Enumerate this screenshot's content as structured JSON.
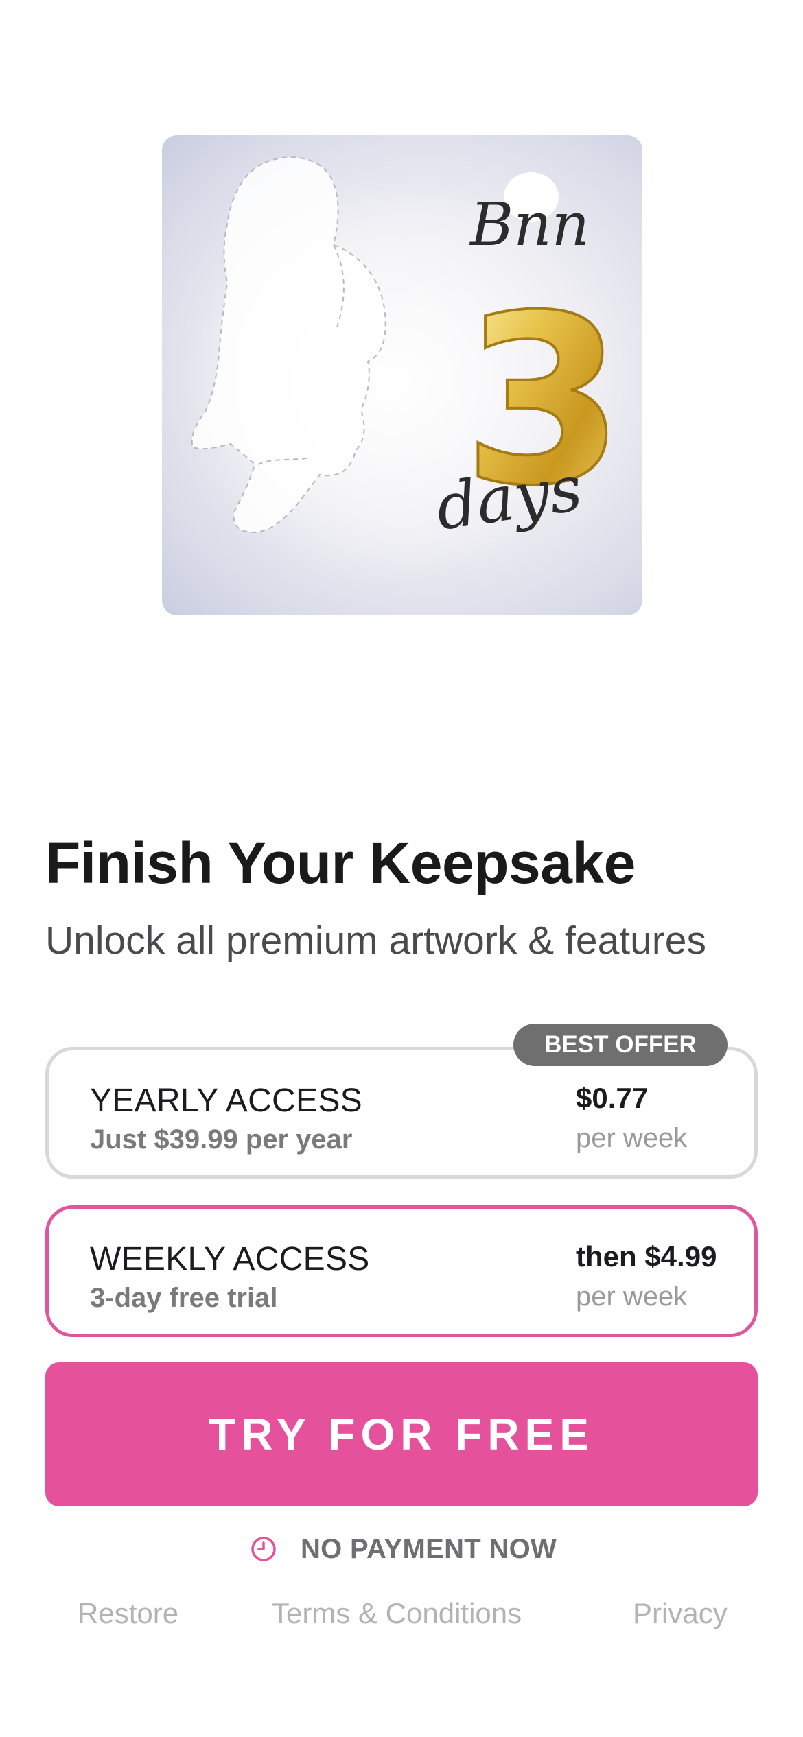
{
  "artwork": {
    "script_text_top": "Bnn",
    "number": "3",
    "script_text_bottom": "days"
  },
  "header": {
    "title": "Finish Your Keepsake",
    "subtitle": "Unlock all premium artwork & features"
  },
  "plans": [
    {
      "name": "YEARLY ACCESS",
      "detail": "Just $39.99 per year",
      "price": "$0.77",
      "unit": "per week",
      "badge": "BEST OFFER",
      "selected": false
    },
    {
      "name": "WEEKLY ACCESS",
      "detail": "3-day free trial",
      "price": "then $4.99",
      "unit": "per week",
      "selected": true
    }
  ],
  "cta": {
    "label": "TRY FOR FREE"
  },
  "notice": {
    "icon": "clock-icon",
    "text": "NO PAYMENT NOW"
  },
  "footer": {
    "restore": "Restore",
    "terms": "Terms & Conditions",
    "privacy": "Privacy"
  },
  "colors": {
    "accent": "#e5529b",
    "badge": "#6f6f70",
    "border_unselected": "#d8d8da",
    "gold": "#d4aa2a"
  }
}
